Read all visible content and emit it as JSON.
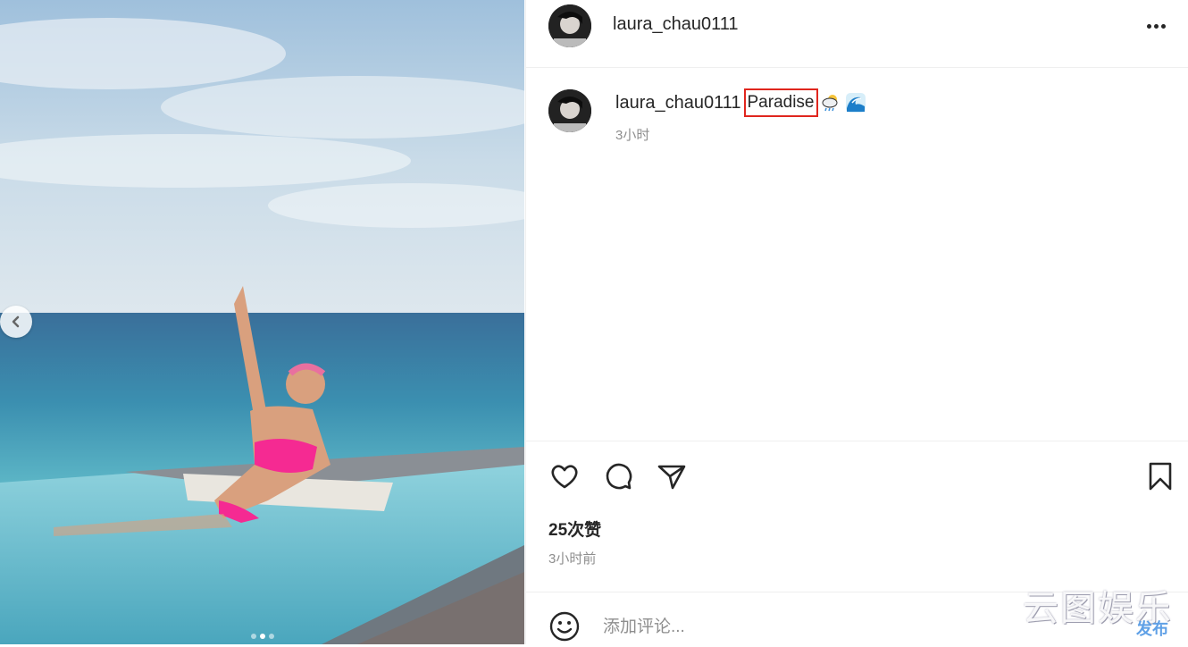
{
  "post": {
    "username": "laura_chau0111",
    "caption_text": "Paradise",
    "caption_emojis": [
      "rain-cloud-emoji",
      "wave-emoji"
    ],
    "caption_time": "3小时",
    "likes": "25次赞",
    "timestamp": "3小时前"
  },
  "comment": {
    "placeholder": "添加评论..."
  },
  "carousel": {
    "slide_count": 3,
    "active_index": 1
  },
  "icons": [
    "chevron-left-icon",
    "more-icon",
    "heart-icon",
    "comment-icon",
    "share-icon",
    "bookmark-icon",
    "smile-icon"
  ],
  "watermark": {
    "main": "云图娱乐",
    "sub": "发布"
  },
  "colors": {
    "highlight_box": "#e0261e",
    "text": "#262626",
    "secondary_text": "#8e8e8e",
    "divider": "#efefef"
  }
}
